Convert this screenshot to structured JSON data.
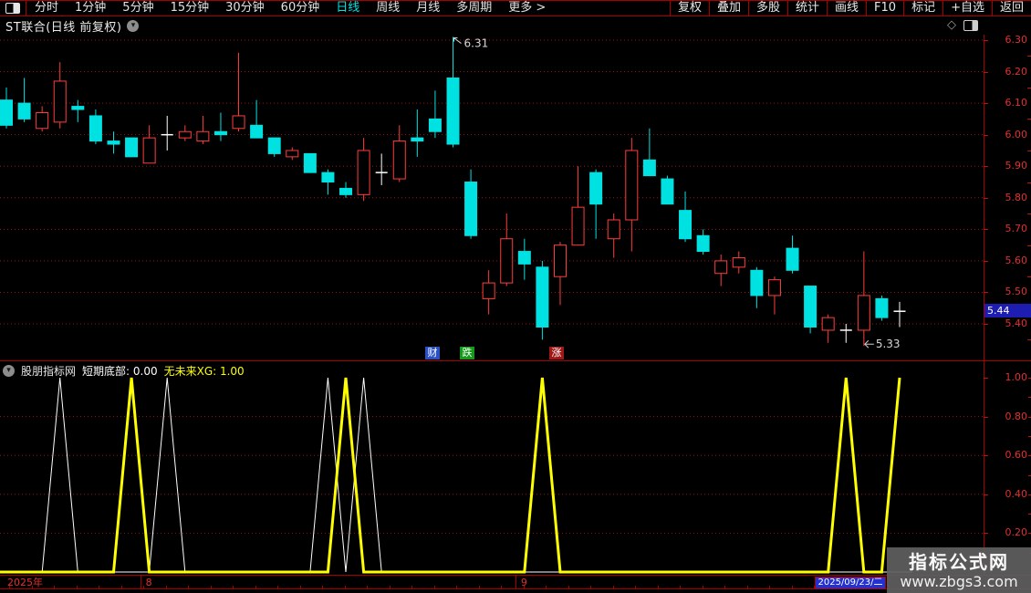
{
  "menu_bar": {
    "left_items": [
      "分时",
      "1分钟",
      "5分钟",
      "15分钟",
      "30分钟",
      "60分钟",
      "日线",
      "周线",
      "月线",
      "多周期",
      "更多 >"
    ],
    "active_item": "日线",
    "right_items": [
      "复权",
      "叠加",
      "多股",
      "统计",
      "画线",
      "F10",
      "标记",
      "+自选",
      "返回"
    ]
  },
  "title_bar": {
    "title": "ST联合(日线 前复权)"
  },
  "price_chart": {
    "current_price_tag": "5.44",
    "badges": [
      {
        "text": "财",
        "color": "#2b50c4",
        "x": 466
      },
      {
        "text": "跌",
        "color": "#14991a",
        "x": 504
      },
      {
        "text": "涨",
        "color": "#9e1818",
        "x": 602
      }
    ]
  },
  "indicator_panel": {
    "source_label": "股朋指标网",
    "series1_label": "短期底部: 0.00",
    "series2_label": "无未来XG: 1.00",
    "series1_color": "#ffffff",
    "series2_color": "#ffff00",
    "axis_labels": [
      "1.00",
      "0.80",
      "0.60",
      "0.40",
      "0.20"
    ]
  },
  "timeline": {
    "year_label": "2025年",
    "month_labels": [
      {
        "text": "8",
        "bar_index": 8
      },
      {
        "text": "9",
        "bar_index": 29
      }
    ],
    "date_tag": "2025/09/23/二"
  },
  "watermark": {
    "line1": "指标公式网",
    "line2": "www.zbgs3.com"
  },
  "chart_data": {
    "type": "candlestick",
    "title": "ST联合(日线 前复权)",
    "price_axis_ticks": [
      6.3,
      6.2,
      6.1,
      6.0,
      5.9,
      5.8,
      5.7,
      5.6,
      5.5,
      5.4
    ],
    "ylim": [
      5.33,
      6.32
    ],
    "up_color": "#ff3d3d",
    "down_color": "#00e2e2",
    "doji_color": "#ffffff",
    "grid_color": "#9c1212",
    "candles": [
      [
        6.11,
        6.15,
        6.02,
        6.03
      ],
      [
        6.1,
        6.18,
        6.04,
        6.05
      ],
      [
        6.02,
        6.09,
        6.01,
        6.07
      ],
      [
        6.04,
        6.23,
        6.02,
        6.17
      ],
      [
        6.09,
        6.11,
        6.04,
        6.08
      ],
      [
        6.06,
        6.08,
        5.97,
        5.98
      ],
      [
        5.98,
        6.01,
        5.94,
        5.97
      ],
      [
        5.99,
        5.99,
        5.93,
        5.93
      ],
      [
        5.91,
        6.03,
        5.91,
        5.99
      ],
      [
        6.0,
        6.06,
        5.95,
        6.0
      ],
      [
        5.99,
        6.03,
        5.98,
        6.01
      ],
      [
        5.98,
        6.06,
        5.97,
        6.01
      ],
      [
        6.01,
        6.07,
        5.98,
        6.0
      ],
      [
        6.02,
        6.26,
        6.01,
        6.06
      ],
      [
        6.03,
        6.11,
        5.99,
        5.99
      ],
      [
        5.99,
        5.99,
        5.93,
        5.94
      ],
      [
        5.93,
        5.96,
        5.92,
        5.95
      ],
      [
        5.94,
        5.94,
        5.88,
        5.88
      ],
      [
        5.88,
        5.89,
        5.81,
        5.85
      ],
      [
        5.83,
        5.85,
        5.8,
        5.81
      ],
      [
        5.81,
        5.99,
        5.79,
        5.95
      ],
      [
        5.88,
        5.94,
        5.84,
        5.88
      ],
      [
        5.86,
        6.03,
        5.85,
        5.98
      ],
      [
        5.99,
        6.08,
        5.93,
        5.98
      ],
      [
        6.05,
        6.14,
        5.99,
        6.01
      ],
      [
        6.18,
        6.31,
        5.96,
        5.97
      ],
      [
        5.85,
        5.89,
        5.67,
        5.68
      ],
      [
        5.48,
        5.57,
        5.43,
        5.53
      ],
      [
        5.53,
        5.75,
        5.52,
        5.67
      ],
      [
        5.63,
        5.67,
        5.54,
        5.59
      ],
      [
        5.58,
        5.6,
        5.35,
        5.39
      ],
      [
        5.55,
        5.66,
        5.46,
        5.65
      ],
      [
        5.65,
        5.9,
        5.65,
        5.77
      ],
      [
        5.88,
        5.89,
        5.67,
        5.78
      ],
      [
        5.67,
        5.75,
        5.61,
        5.73
      ],
      [
        5.73,
        5.99,
        5.63,
        5.95
      ],
      [
        5.92,
        6.02,
        5.87,
        5.87
      ],
      [
        5.86,
        5.87,
        5.78,
        5.78
      ],
      [
        5.76,
        5.82,
        5.66,
        5.67
      ],
      [
        5.68,
        5.7,
        5.62,
        5.63
      ],
      [
        5.56,
        5.62,
        5.52,
        5.6
      ],
      [
        5.58,
        5.63,
        5.56,
        5.61
      ],
      [
        5.57,
        5.58,
        5.45,
        5.49
      ],
      [
        5.49,
        5.55,
        5.43,
        5.54
      ],
      [
        5.64,
        5.68,
        5.56,
        5.57
      ],
      [
        5.52,
        5.52,
        5.37,
        5.39
      ],
      [
        5.38,
        5.43,
        5.34,
        5.42
      ],
      [
        5.38,
        5.4,
        5.34,
        5.38
      ],
      [
        5.38,
        5.63,
        5.33,
        5.49
      ],
      [
        5.48,
        5.49,
        5.41,
        5.42
      ],
      [
        5.44,
        5.47,
        5.39,
        5.44
      ]
    ],
    "annotations": [
      {
        "value": "6.31",
        "candle_index": 25,
        "attach": "high"
      },
      {
        "value": "5.33",
        "candle_index": 48,
        "attach": "low"
      }
    ],
    "sub_indicator": {
      "name": "短期底部 / 无未来XG",
      "axis_ticks": [
        1.0,
        0.8,
        0.6,
        0.4,
        0.2
      ],
      "base_value": 0.0,
      "peak_value": 1.0,
      "white_peak_bar_indices": [
        3,
        9,
        18,
        20
      ],
      "yellow_peak_bar_indices": [
        7,
        19,
        30,
        47,
        50
      ]
    }
  }
}
